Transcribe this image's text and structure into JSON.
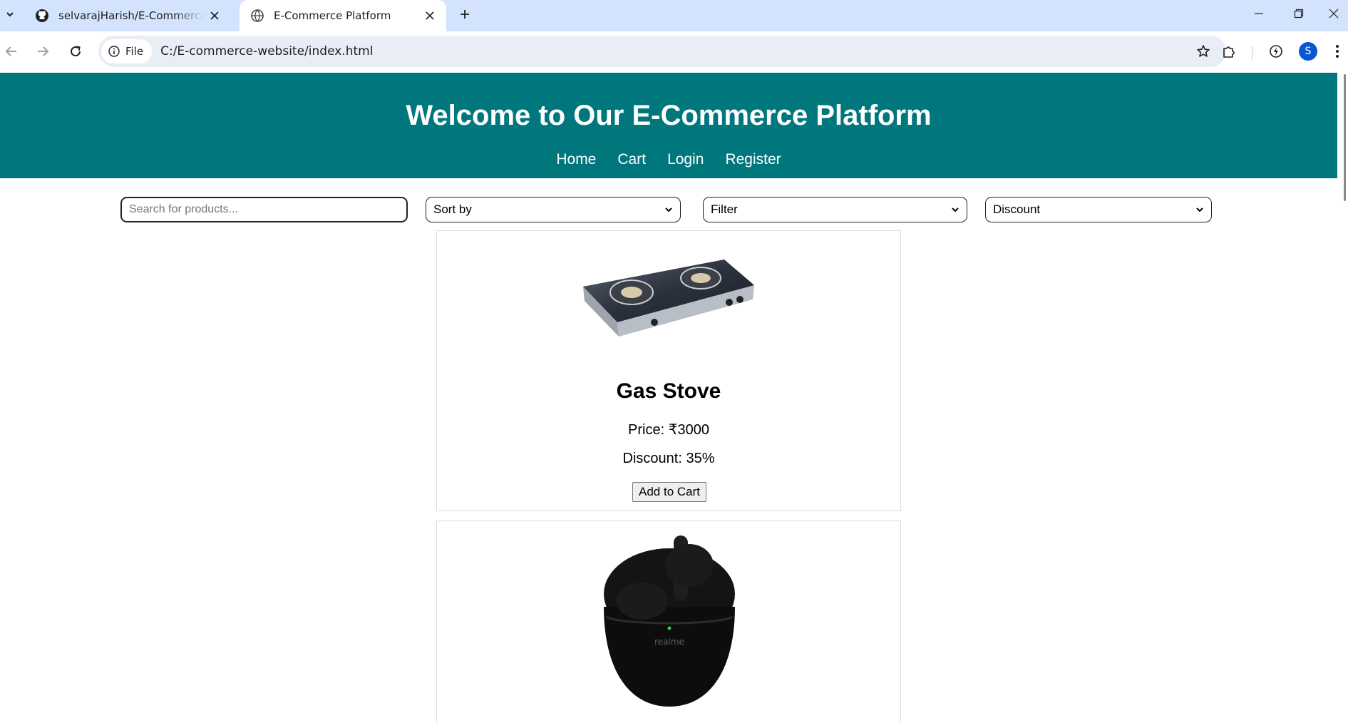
{
  "browser": {
    "tabs": [
      {
        "title": "selvarajHarish/E-Commerce-website",
        "active": false
      },
      {
        "title": "E-Commerce Platform",
        "active": true
      }
    ],
    "chip_label": "File",
    "url": "C:/E-commerce-website/index.html",
    "profile_initial": "S"
  },
  "site": {
    "title": "Welcome to Our E-Commerce Platform",
    "nav": [
      "Home",
      "Cart",
      "Login",
      "Register"
    ],
    "colors": {
      "header_bg": "#00777d",
      "header_text": "#ffffff"
    }
  },
  "controls": {
    "search_placeholder": "Search for products...",
    "sort_label": "Sort by",
    "filter_label": "Filter",
    "discount_label": "Discount"
  },
  "products": [
    {
      "name": "Gas Stove",
      "price": "Price: ₹3000",
      "discount": "Discount: 35%",
      "button": "Add to Cart",
      "image": "gas-stove-image"
    },
    {
      "image": "earbuds-image",
      "brand_mark": "realme"
    }
  ]
}
